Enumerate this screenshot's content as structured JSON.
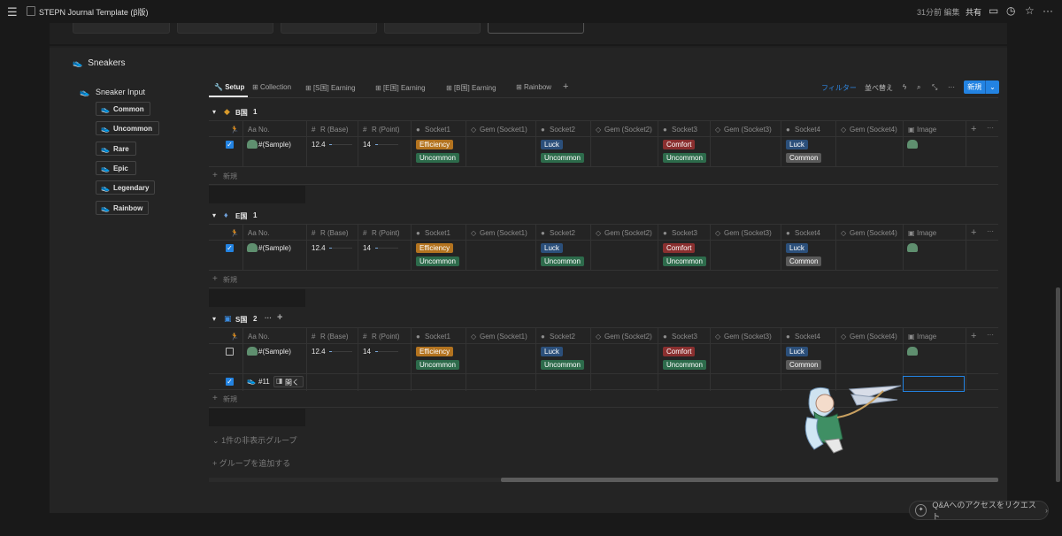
{
  "topbar": {
    "title": "STEPN Journal Template (β版)",
    "edited": "31分前 編集",
    "share": "共有"
  },
  "page": {
    "section_title": "Sneakers",
    "sneaker_input": "Sneaker Input",
    "rarity_tags": [
      {
        "label": "Common",
        "color": "#9b9b9b"
      },
      {
        "label": "Uncommon",
        "color": "#3aa66e"
      },
      {
        "label": "Rare",
        "color": "#3b8ce0"
      },
      {
        "label": "Epic",
        "color": "#9a7fe0"
      },
      {
        "label": "Legendary",
        "color": "#e0902a"
      },
      {
        "label": "Rainbow",
        "color": "#e0457a"
      }
    ]
  },
  "views": {
    "tabs": [
      "Setup",
      "Collection",
      "[S国] Earning",
      "[E国] Earning",
      "[B国] Earning",
      "Rainbow"
    ],
    "filter": "フィルター",
    "sort": "並べ替え",
    "new": "新規"
  },
  "table": {
    "columns": [
      "No.",
      "R (Base)",
      "R (Point)",
      "Socket1",
      "Gem (Socket1)",
      "Socket2",
      "Gem (Socket2)",
      "Socket3",
      "Gem (Socket3)",
      "Socket4",
      "Gem (Socket4)",
      "Image"
    ],
    "name_prefix": "Aa",
    "new_row": "新規",
    "groups": [
      {
        "name": "B国",
        "count": "1",
        "rows": [
          {
            "checked": true,
            "no": "#(Sample)",
            "r_base": "12.4",
            "r_point": "14",
            "s1": [
              "Efficiency",
              "Uncommon"
            ],
            "s2": [
              "Luck",
              "Uncommon"
            ],
            "s3": [
              "Comfort",
              "Uncommon"
            ],
            "s4": [
              "Luck",
              "Common"
            ]
          }
        ]
      },
      {
        "name": "E国",
        "count": "1",
        "rows": [
          {
            "checked": true,
            "no": "#(Sample)",
            "r_base": "12.4",
            "r_point": "14",
            "s1": [
              "Efficiency",
              "Uncommon"
            ],
            "s2": [
              "Luck",
              "Uncommon"
            ],
            "s3": [
              "Comfort",
              "Uncommon"
            ],
            "s4": [
              "Luck",
              "Common"
            ]
          }
        ]
      },
      {
        "name": "S国",
        "count": "2",
        "rows": [
          {
            "checked": false,
            "no": "#(Sample)",
            "r_base": "12.4",
            "r_point": "14",
            "s1": [
              "Efficiency",
              "Uncommon"
            ],
            "s2": [
              "Luck",
              "Uncommon"
            ],
            "s3": [
              "Comfort",
              "Uncommon"
            ],
            "s4": [
              "Luck",
              "Common"
            ]
          },
          {
            "checked": true,
            "no": "#11",
            "open_label": "開く"
          }
        ]
      }
    ],
    "hidden_groups": "1件の非表示グループ",
    "add_group": "グループを追加する"
  },
  "qa": "Q&Aへのアクセスをリクエスト"
}
